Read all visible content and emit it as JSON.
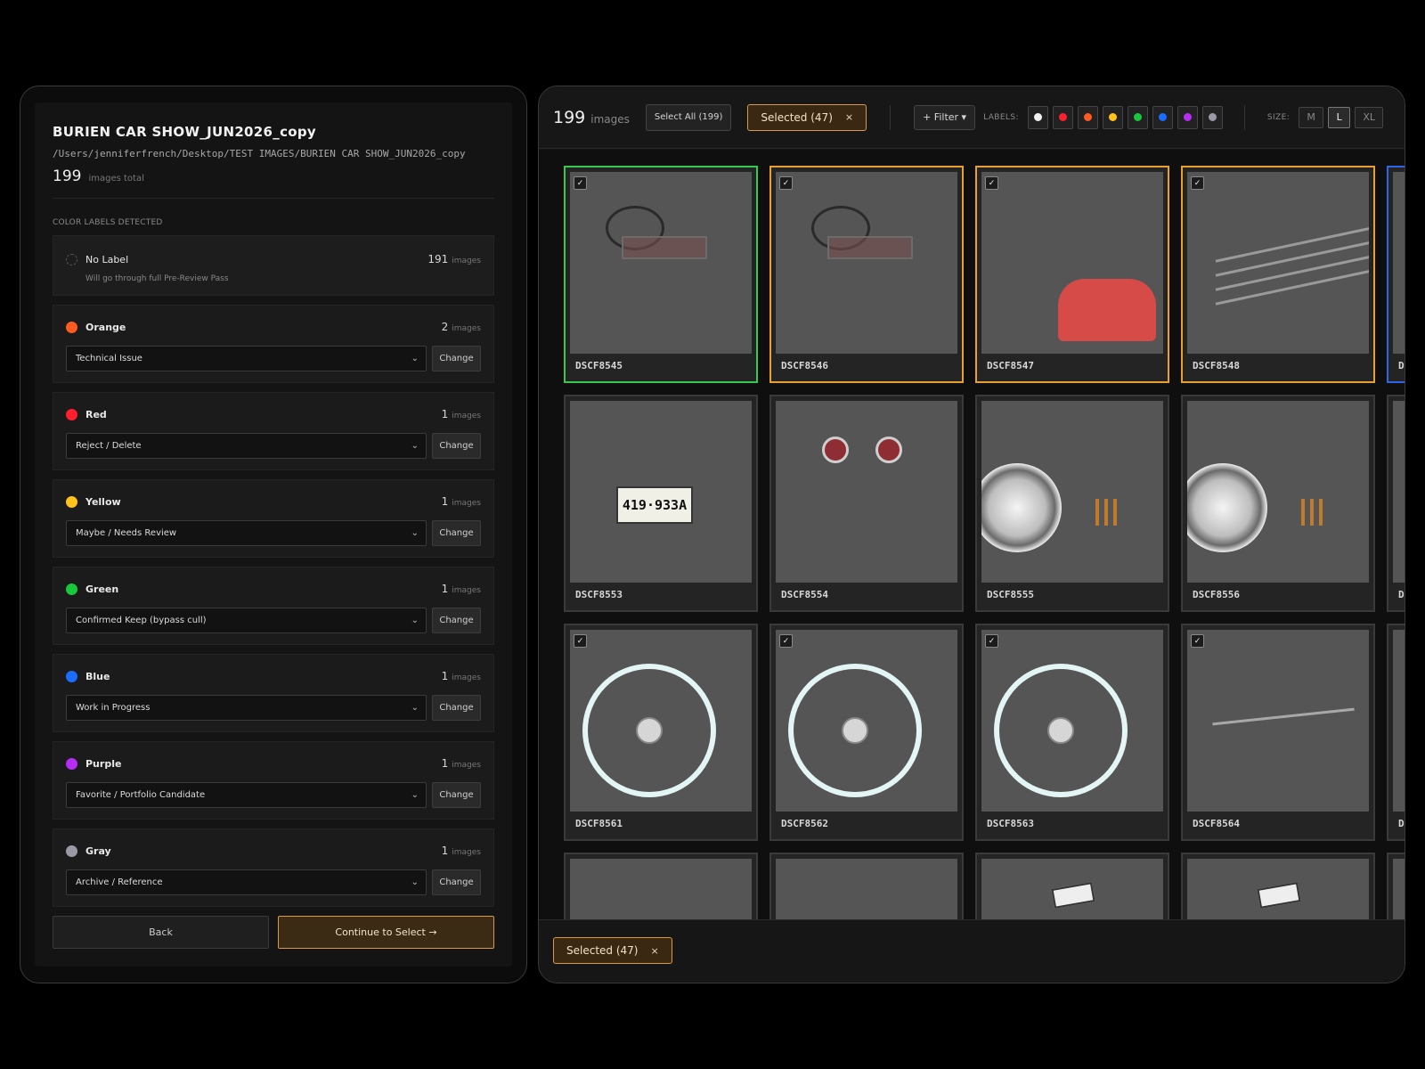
{
  "left": {
    "title": "BURIEN CAR SHOW_JUN2026_copy",
    "path": "/Users/jenniferfrench/Desktop/TEST IMAGES/BURIEN CAR SHOW_JUN2026_copy",
    "total_count": "199",
    "total_label": "images total",
    "section_label": "COLOR LABELS DETECTED",
    "no_label": {
      "name": "No Label",
      "count": "191",
      "unit": "images",
      "note": "Will go through full Pre-Review Pass"
    },
    "labels": [
      {
        "name": "Orange",
        "color": "#ff5a1f",
        "count": "2",
        "unit": "images",
        "value": "Technical Issue",
        "change": "Change"
      },
      {
        "name": "Red",
        "color": "#ff1f2e",
        "count": "1",
        "unit": "images",
        "value": "Reject / Delete",
        "change": "Change"
      },
      {
        "name": "Yellow",
        "color": "#ffc21a",
        "count": "1",
        "unit": "images",
        "value": "Maybe / Needs Review",
        "change": "Change"
      },
      {
        "name": "Green",
        "color": "#19c83a",
        "count": "1",
        "unit": "images",
        "value": "Confirmed Keep (bypass cull)",
        "change": "Change"
      },
      {
        "name": "Blue",
        "color": "#1a6dff",
        "count": "1",
        "unit": "images",
        "value": "Work in Progress",
        "change": "Change"
      },
      {
        "name": "Purple",
        "color": "#b62ef2",
        "count": "1",
        "unit": "images",
        "value": "Favorite / Portfolio Candidate",
        "change": "Change"
      },
      {
        "name": "Gray",
        "color": "#9a9aa6",
        "count": "1",
        "unit": "images",
        "value": "Archive / Reference",
        "change": "Change"
      }
    ],
    "back": "Back",
    "continue": "Continue to Select →"
  },
  "topbar": {
    "count": "199",
    "count_label": "images",
    "select_all": "Select All (199)",
    "selected": "Selected (47)",
    "close": "×",
    "filter": "+ Filter ▾",
    "labels_title": "LABELS:",
    "label_swatches": [
      "#f2f2f2",
      "#ff1f2e",
      "#ff5a1f",
      "#ffc21a",
      "#19c83a",
      "#1a6dff",
      "#b62ef2",
      "#9a9aa6"
    ],
    "size_title": "SIZE:",
    "sizes": [
      "M",
      "L",
      "XL"
    ],
    "active_size": "L"
  },
  "tiles": [
    {
      "name": "DSCF8545",
      "checked": true,
      "border": "#37c84f",
      "art": "art-red-interior"
    },
    {
      "name": "DSCF8546",
      "checked": true,
      "border": "#e8a12c",
      "art": "art-red-interior"
    },
    {
      "name": "DSCF8547",
      "checked": true,
      "border": "#e8a12c",
      "art": "art-street"
    },
    {
      "name": "DSCF8548",
      "checked": true,
      "border": "#e8a12c",
      "art": "art-chrome"
    },
    {
      "name": "DSCF8553",
      "checked": false,
      "border": "#3a3a3a",
      "art": "art-teal-spare"
    },
    {
      "name": "DSCF8554",
      "checked": false,
      "border": "#3a3a3a",
      "art": "art-engine"
    },
    {
      "name": "DSCF8555",
      "checked": false,
      "border": "#3a3a3a",
      "art": "art-teal-light"
    },
    {
      "name": "DSCF8556",
      "checked": false,
      "border": "#3a3a3a",
      "art": "art-teal-light"
    },
    {
      "name": "DSCF8561",
      "checked": true,
      "border": "#3a3a3a",
      "art": "art-teal-wheel"
    },
    {
      "name": "DSCF8562",
      "checked": true,
      "border": "#3a3a3a",
      "art": "art-teal-wheel"
    },
    {
      "name": "DSCF8563",
      "checked": true,
      "border": "#3a3a3a",
      "art": "art-teal-wheel"
    },
    {
      "name": "DSCF8564",
      "checked": true,
      "border": "#3a3a3a",
      "art": "art-white-car"
    }
  ],
  "plate_text": "419·933A",
  "partial_labels": [
    "D",
    "D",
    "D"
  ],
  "bottom": {
    "selected": "Selected (47)",
    "close": "×"
  }
}
